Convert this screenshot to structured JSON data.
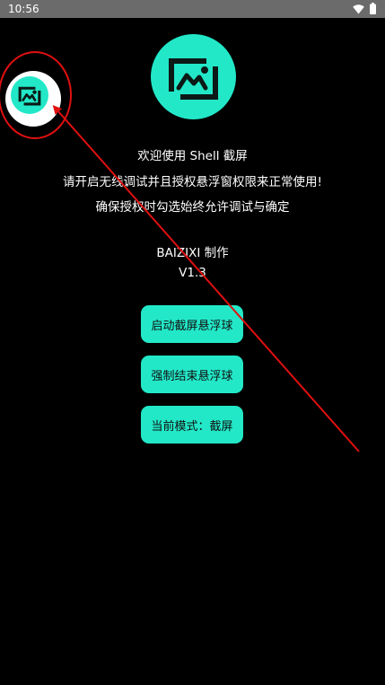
{
  "status_bar": {
    "time": "10:56",
    "icons": [
      "wifi-icon",
      "battery-icon"
    ],
    "background": "#6b6b6b"
  },
  "app": {
    "logo_icon": "screenshot-gallery-icon",
    "accent_color": "#22e8c8",
    "welcome": "欢迎使用 Shell 截屏",
    "instruction_1": "请开启无线调试并且授权悬浮窗权限来正常使用!",
    "instruction_2": "确保授权时勾选始终允许调试与确定",
    "author": "BAIZIXI 制作",
    "version": "V1.3"
  },
  "buttons": {
    "start_float": "启动截屏悬浮球",
    "stop_float": "强制结束悬浮球",
    "current_mode": "当前模式：截屏"
  },
  "floating_ball": {
    "icon": "screenshot-gallery-icon"
  },
  "annotation": {
    "color": "#e01010"
  }
}
